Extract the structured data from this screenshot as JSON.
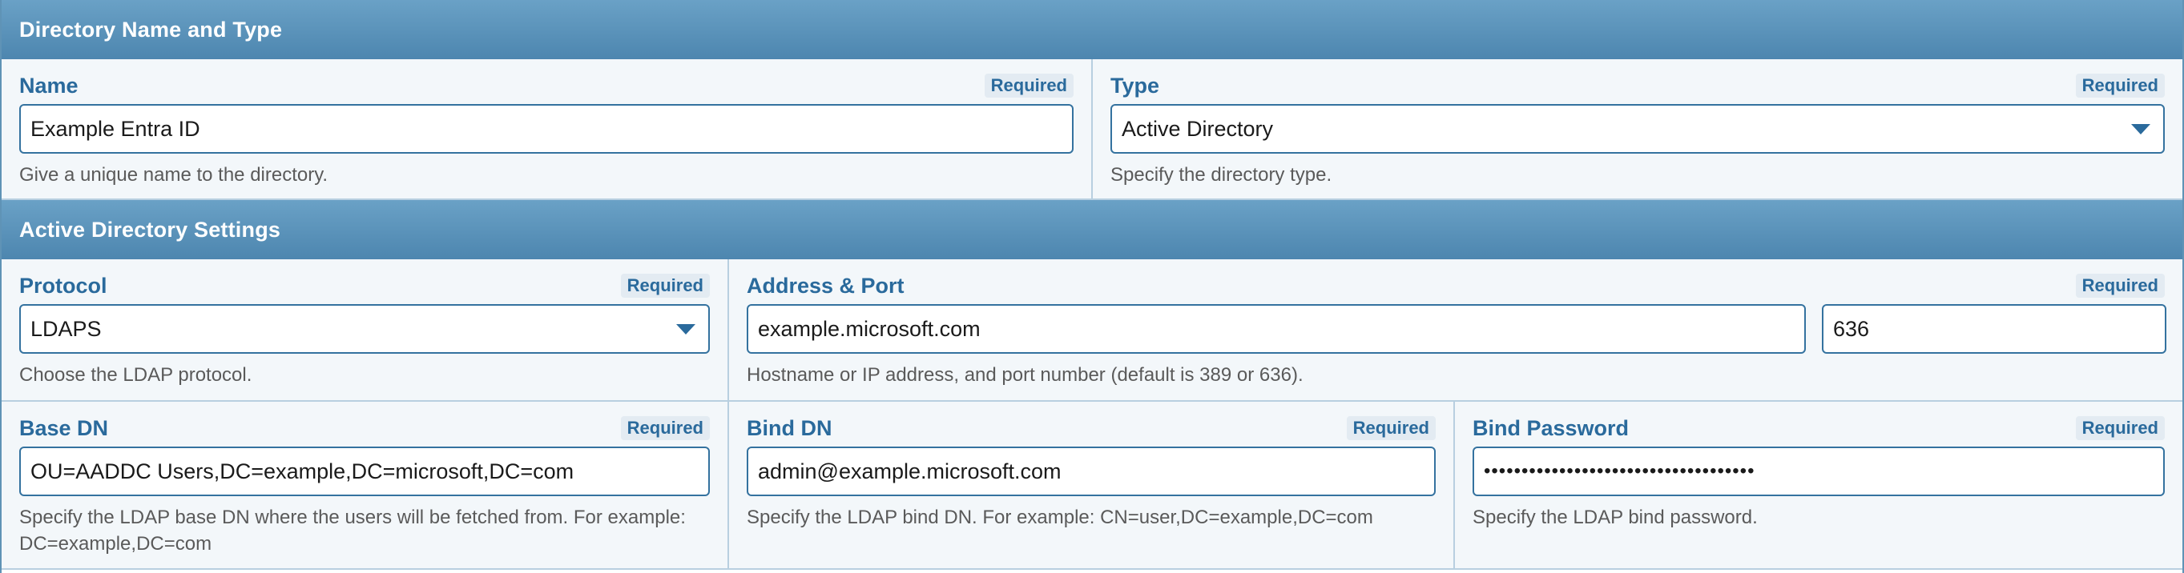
{
  "sections": {
    "directory": {
      "title": "Directory Name and Type",
      "name": {
        "label": "Name",
        "required": "Required",
        "value": "Example Entra ID",
        "help": "Give a unique name to the directory."
      },
      "type": {
        "label": "Type",
        "required": "Required",
        "value": "Active Directory",
        "help": "Specify the directory type."
      }
    },
    "ad_settings": {
      "title": "Active Directory Settings",
      "protocol": {
        "label": "Protocol",
        "required": "Required",
        "value": "LDAPS",
        "help": "Choose the LDAP protocol."
      },
      "address_port": {
        "label": "Address & Port",
        "required": "Required",
        "address_value": "example.microsoft.com",
        "port_value": "636",
        "help": "Hostname or IP address, and port number (default is 389 or 636)."
      },
      "base_dn": {
        "label": "Base DN",
        "required": "Required",
        "value": "OU=AADDC Users,DC=example,DC=microsoft,DC=com",
        "help": "Specify the LDAP base DN where the users will be fetched from. For example: DC=example,DC=com"
      },
      "bind_dn": {
        "label": "Bind DN",
        "required": "Required",
        "value": "admin@example.microsoft.com",
        "help": "Specify the LDAP bind DN. For example: CN=user,DC=example,DC=com"
      },
      "bind_password": {
        "label": "Bind Password",
        "required": "Required",
        "value": "••••••••••••••••••••••••••••••••••••",
        "help": "Specify the LDAP bind password."
      }
    }
  },
  "icons": {
    "dropdown": "chevron-down-icon"
  },
  "colors": {
    "header": "#5a93bb",
    "label": "#2a6a9c",
    "input_border": "#34729f",
    "row_bg": "#f3f7fa"
  }
}
